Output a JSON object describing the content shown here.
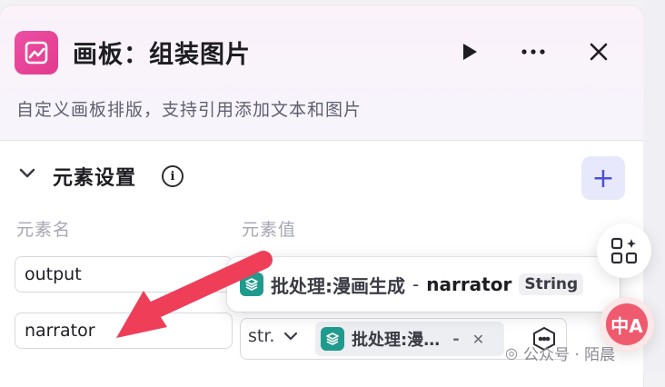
{
  "header": {
    "title": "画板：组装图片",
    "subtitle": "自定义画板排版，支持引用添加文本和图片"
  },
  "section": {
    "title": "元素设置",
    "col_name": "元素名",
    "col_value": "元素值"
  },
  "rows": [
    {
      "name": "output"
    },
    {
      "name": "narrator",
      "type": "str.",
      "chip": "批处理:漫…",
      "chip_sep": "-"
    }
  ],
  "tooltip": {
    "node": "批处理:漫画生成",
    "sep": "-",
    "field": "narrator",
    "type": "String"
  },
  "floating": {
    "lang_label": "中A"
  },
  "watermark": {
    "text": "公众号 · 陌晨"
  },
  "colors": {
    "accent": "#4a4fd9",
    "app_icon": "#e23a8d",
    "node": "#1f9b8e",
    "arrow": "#ef3e58"
  }
}
